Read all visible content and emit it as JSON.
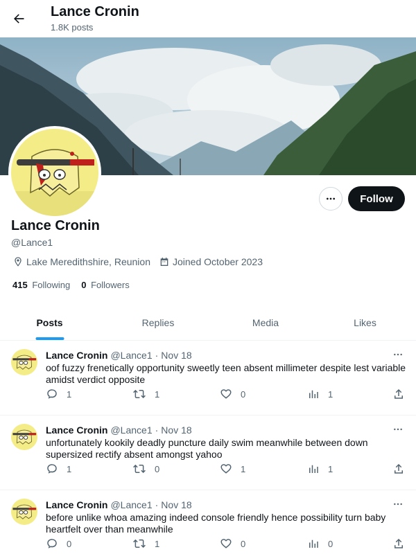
{
  "header": {
    "title": "Lance Cronin",
    "post_count": "1.8K posts"
  },
  "profile": {
    "name": "Lance Cronin",
    "handle": "@Lance1",
    "location": "Lake Meredithshire, Reunion",
    "joined": "Joined October 2023",
    "following_count": "415",
    "following_label": "Following",
    "followers_count": "0",
    "followers_label": "Followers",
    "follow_label": "Follow"
  },
  "tabs": [
    {
      "label": "Posts",
      "active": true
    },
    {
      "label": "Replies",
      "active": false
    },
    {
      "label": "Media",
      "active": false
    },
    {
      "label": "Likes",
      "active": false
    }
  ],
  "tweets": [
    {
      "name": "Lance Cronin",
      "handle": "@Lance1",
      "sep": "·",
      "date": "Nov 18",
      "text": "oof fuzzy frenetically opportunity sweetly teen absent millimeter despite lest variable amidst verdict opposite",
      "replies": "1",
      "retweets": "1",
      "likes": "0",
      "views": "1"
    },
    {
      "name": "Lance Cronin",
      "handle": "@Lance1",
      "sep": "·",
      "date": "Nov 18",
      "text": "unfortunately kookily deadly puncture daily swim meanwhile between down supersized rectify absent amongst yahoo",
      "replies": "1",
      "retweets": "0",
      "likes": "1",
      "views": "1"
    },
    {
      "name": "Lance Cronin",
      "handle": "@Lance1",
      "sep": "·",
      "date": "Nov 18",
      "text": "before unlike whoa amazing indeed console friendly hence possibility turn baby heartfelt over than meanwhile",
      "replies": "0",
      "retweets": "1",
      "likes": "0",
      "views": "0"
    }
  ],
  "colors": {
    "accent": "#1d9bf0",
    "text": "#0f1419",
    "muted": "#536471",
    "follow_bg": "#0f1419"
  }
}
